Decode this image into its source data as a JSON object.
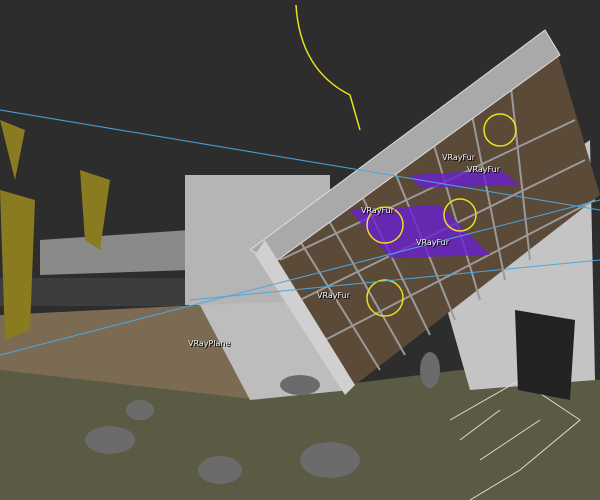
{
  "viewport": {
    "labels": [
      {
        "text": "VRayFur"
      },
      {
        "text": "VRayFur"
      },
      {
        "text": "VRayFur"
      },
      {
        "text": "VRayFur"
      },
      {
        "text": "VRayFur"
      },
      {
        "text": "VRayPlane"
      }
    ]
  },
  "colors": {
    "background": "#2d2d2d",
    "helper_yellow": "#e8e020",
    "fur_purple": "#6a1fd0",
    "line_cyan": "#4aa8e0"
  }
}
